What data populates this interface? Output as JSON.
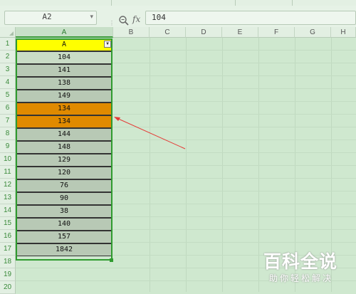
{
  "name_box": {
    "value": "A2"
  },
  "formula_bar": {
    "fx_label": "fx",
    "value": "104"
  },
  "columns": [
    "A",
    "B",
    "C",
    "D",
    "E",
    "F",
    "G",
    "H"
  ],
  "rows": [
    "1",
    "2",
    "3",
    "4",
    "5",
    "6",
    "7",
    "8",
    "9",
    "10",
    "11",
    "12",
    "13",
    "14",
    "15",
    "16",
    "17",
    "18",
    "19",
    "20"
  ],
  "column_a": {
    "header": "A",
    "values": [
      "104",
      "141",
      "138",
      "149",
      "134",
      "134",
      "144",
      "148",
      "129",
      "120",
      "76",
      "90",
      "38",
      "140",
      "157",
      "1842"
    ]
  },
  "highlighted_rows": [
    6,
    7
  ],
  "colors": {
    "highlight": "#e08a00",
    "header_fill": "#ffff00",
    "selection": "#2f9b2f",
    "arrow": "#e53935",
    "background": "#cfe8cf"
  },
  "watermark": {
    "title": "百科全说",
    "subtitle": "助你轻松解决"
  }
}
